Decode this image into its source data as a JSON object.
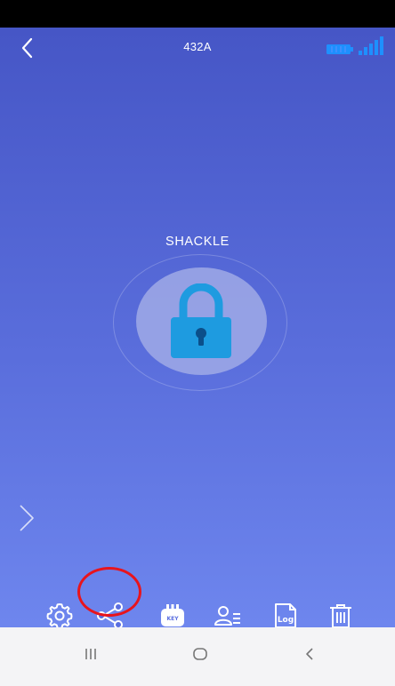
{
  "header": {
    "title": "432A",
    "back_icon": "chevron-left-icon",
    "battery_icon": "battery-icon",
    "signal_icon": "signal-bars-icon"
  },
  "lock": {
    "label": "SHACKLE",
    "icon": "padlock-icon"
  },
  "side": {
    "expand_icon": "chevron-right-icon"
  },
  "toolbar": {
    "items": [
      {
        "name": "settings",
        "icon": "gear-icon"
      },
      {
        "name": "share",
        "icon": "share-icon"
      },
      {
        "name": "key",
        "icon": "key-icon",
        "text": "KEY"
      },
      {
        "name": "users",
        "icon": "user-list-icon"
      },
      {
        "name": "log",
        "icon": "log-icon",
        "text": "Log"
      },
      {
        "name": "delete",
        "icon": "trash-icon"
      }
    ],
    "highlighted": "share"
  },
  "nav_bar": {
    "items": [
      "recent-apps-icon",
      "home-icon",
      "back-icon"
    ]
  },
  "colors": {
    "background_top": "#4656c6",
    "background_bottom": "#6e86ee",
    "lock_blue": "#1e9be0",
    "highlight_red": "#e8141c",
    "battery_blue": "#1e90ff"
  }
}
